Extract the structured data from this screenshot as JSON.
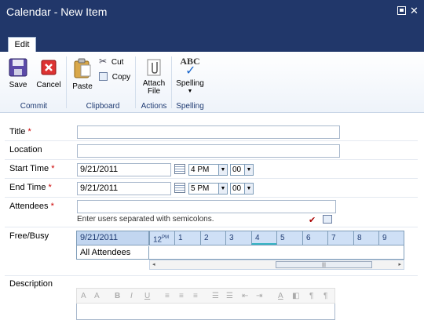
{
  "window": {
    "title": "Calendar - New Item"
  },
  "ribbon": {
    "tab": "Edit",
    "save": "Save",
    "cancel": "Cancel",
    "paste": "Paste",
    "cut": "Cut",
    "copy": "Copy",
    "attach_line1": "Attach",
    "attach_line2": "File",
    "spelling": "Spelling",
    "spell_icon_text": "ABC",
    "groups": {
      "commit": "Commit",
      "clipboard": "Clipboard",
      "actions": "Actions",
      "spelling": "Spelling"
    }
  },
  "form": {
    "title_label": "Title",
    "location_label": "Location",
    "start_label": "Start Time",
    "end_label": "End Time",
    "attendees_label": "Attendees",
    "freebusy_label": "Free/Busy",
    "description_label": "Description",
    "required_mark": "*",
    "title_value": "",
    "location_value": "",
    "start_date": "9/21/2011",
    "start_hour": "4 PM",
    "start_min": "00",
    "end_date": "9/21/2011",
    "end_hour": "5 PM",
    "end_min": "00",
    "attendees_value": "",
    "attendees_hint": "Enter users separated with semicolons."
  },
  "freebusy": {
    "date": "9/21/2011",
    "noon": "12",
    "noon_sup": "PM",
    "hours": [
      "1",
      "2",
      "3",
      "4",
      "5",
      "6",
      "7",
      "8",
      "9"
    ],
    "all_attendees": "All Attendees"
  },
  "colors": {
    "titlebar": "#21376a",
    "accent": "#1f3b72",
    "required": "#cc0000"
  }
}
